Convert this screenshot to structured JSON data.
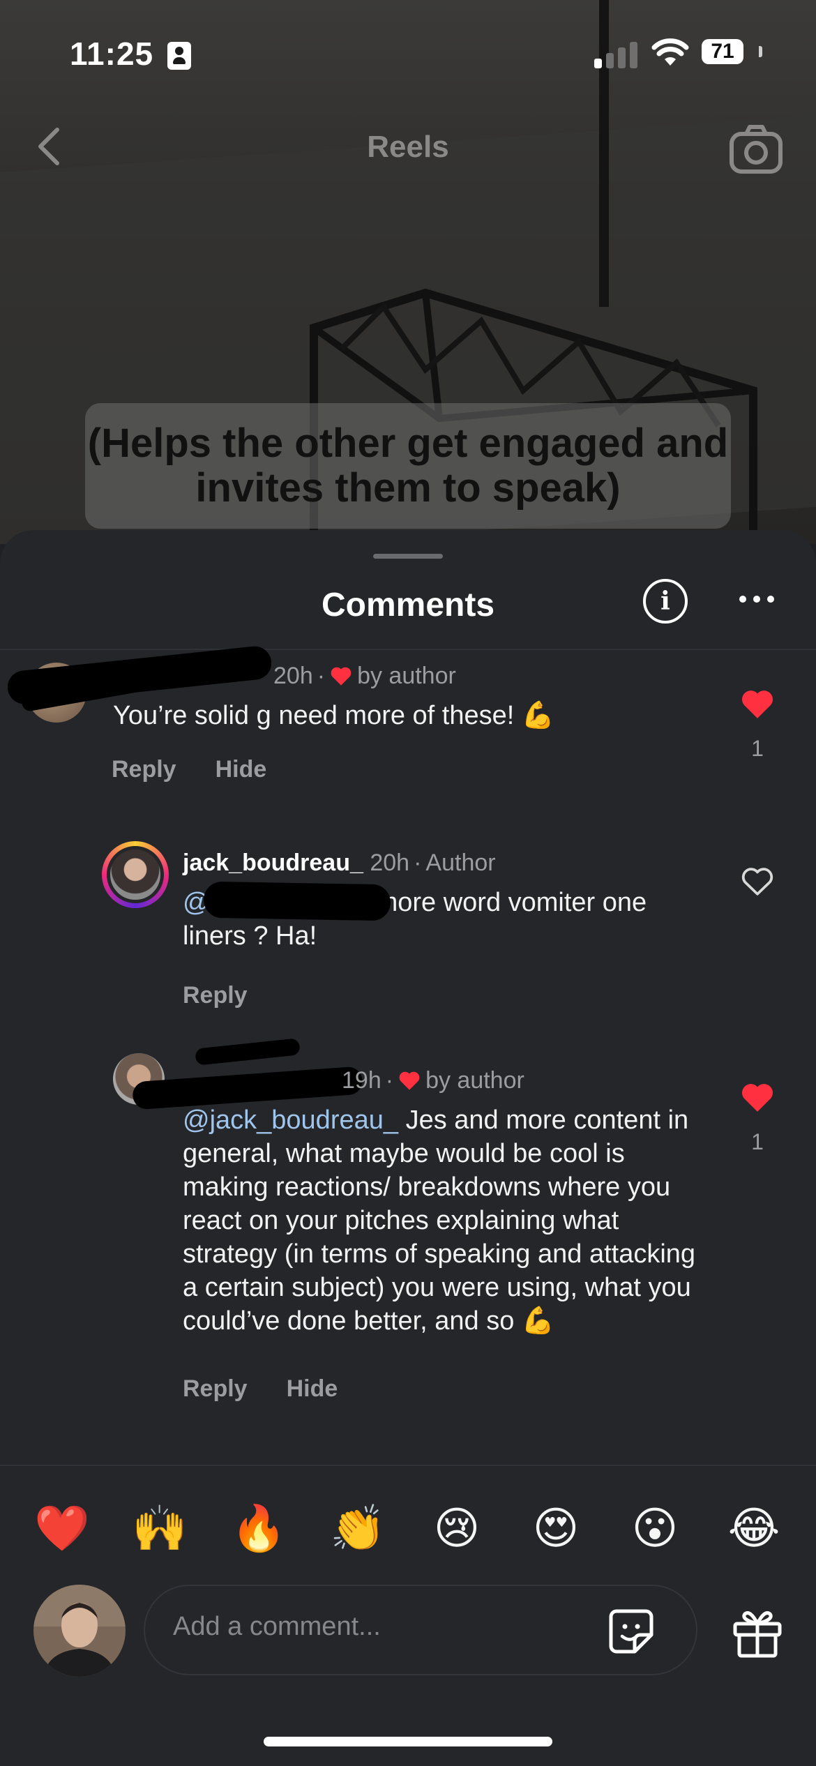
{
  "status_bar": {
    "time": "11:25",
    "battery": "71"
  },
  "nav": {
    "title": "Reels"
  },
  "video": {
    "caption": "(Helps the other get engaged and invites them to speak)"
  },
  "sheet": {
    "title": "Comments"
  },
  "comments": [
    {
      "username": "",
      "time": "20h",
      "badge": "by author",
      "text": "You’re solid g need more of these! 💪",
      "actions": [
        "Reply",
        "Hide"
      ],
      "liked": true,
      "like_count": "1"
    },
    {
      "username": "jack_boudreau_",
      "time": "20h",
      "badge": "Author",
      "mention": "@",
      "text": "more word vomiter one liners ? Ha!",
      "actions": [
        "Reply"
      ],
      "liked": false
    },
    {
      "username": "",
      "time": "19h",
      "badge": "by author",
      "mention": "@jack_boudreau_",
      "text": " Jes and more content in general, what maybe would be cool is making reactions/ breakdowns where you react on your pitches explaining what strategy (in terms of speaking and attacking a certain subject) you were using, what you could’ve done better, and so 💪",
      "actions": [
        "Reply",
        "Hide"
      ],
      "liked": true,
      "like_count": "1"
    }
  ],
  "quick_reactions": [
    "❤️",
    "🙌",
    "🔥",
    "👏",
    "😢",
    "😍",
    "😮",
    "😂"
  ],
  "composer": {
    "placeholder": "Add a comment..."
  },
  "icons": {
    "back": "chevron-left-icon",
    "camera": "camera-icon",
    "info": "info-icon",
    "more": "more-horizontal-icon",
    "like": "heart-icon",
    "sticker": "sticker-icon",
    "gift": "gift-icon"
  },
  "colors": {
    "accent_red": "#ff3040",
    "mention": "#9fc5ec",
    "sheet_bg": "#25262a"
  }
}
